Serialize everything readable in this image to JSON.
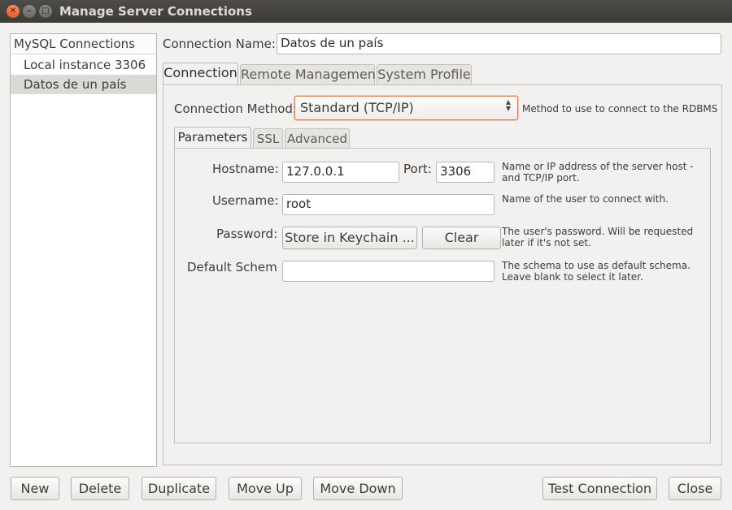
{
  "window": {
    "title": "Manage Server Connections"
  },
  "sidebar": {
    "header": "MySQL Connections",
    "items": [
      {
        "label": "Local instance 3306",
        "selected": false
      },
      {
        "label": "Datos de un país",
        "selected": true
      }
    ]
  },
  "connection_name": {
    "label": "Connection Name:",
    "value": "Datos de un país"
  },
  "tabs": [
    {
      "label": "Connection",
      "active": true
    },
    {
      "label": "Remote Management",
      "active": false
    },
    {
      "label": "System Profile",
      "active": false
    }
  ],
  "connection_method": {
    "label": "Connection Method:",
    "value": "Standard (TCP/IP)",
    "help": "Method to use to connect to the RDBMS"
  },
  "subtabs": [
    {
      "label": "Parameters",
      "active": true
    },
    {
      "label": "SSL",
      "active": false
    },
    {
      "label": "Advanced",
      "active": false
    }
  ],
  "params": {
    "hostname": {
      "label": "Hostname:",
      "value": "127.0.0.1"
    },
    "port": {
      "label": "Port:",
      "value": "3306"
    },
    "hostname_help_1": "Name or IP address of the server host -",
    "hostname_help_2": "and TCP/IP port.",
    "username": {
      "label": "Username:",
      "value": "root",
      "help": "Name of the user to connect with."
    },
    "password": {
      "label": "Password:",
      "store_button": "Store in Keychain ...",
      "clear_button": "Clear",
      "help_1": "The user's password. Will be requested",
      "help_2": "later if it's not set."
    },
    "schema": {
      "label": "Default Schema:",
      "value": "",
      "help_1": "The schema to use as default schema.",
      "help_2": "Leave blank to select it later."
    }
  },
  "bottom_buttons": {
    "new": "New",
    "delete": "Delete",
    "duplicate": "Duplicate",
    "move_up": "Move Up",
    "move_down": "Move Down",
    "test_connection": "Test Connection",
    "close": "Close"
  },
  "colors": {
    "titlebar": "#3c3b37",
    "close_button": "#e25b29",
    "focus_accent": "#e07b4b",
    "window_bg": "#f2f1f0",
    "selection": "#dcdad5"
  },
  "icons": {
    "close": "close-icon",
    "minimize": "minimize-icon",
    "maximize": "maximize-icon",
    "select_arrows": "updown-arrows-icon"
  }
}
